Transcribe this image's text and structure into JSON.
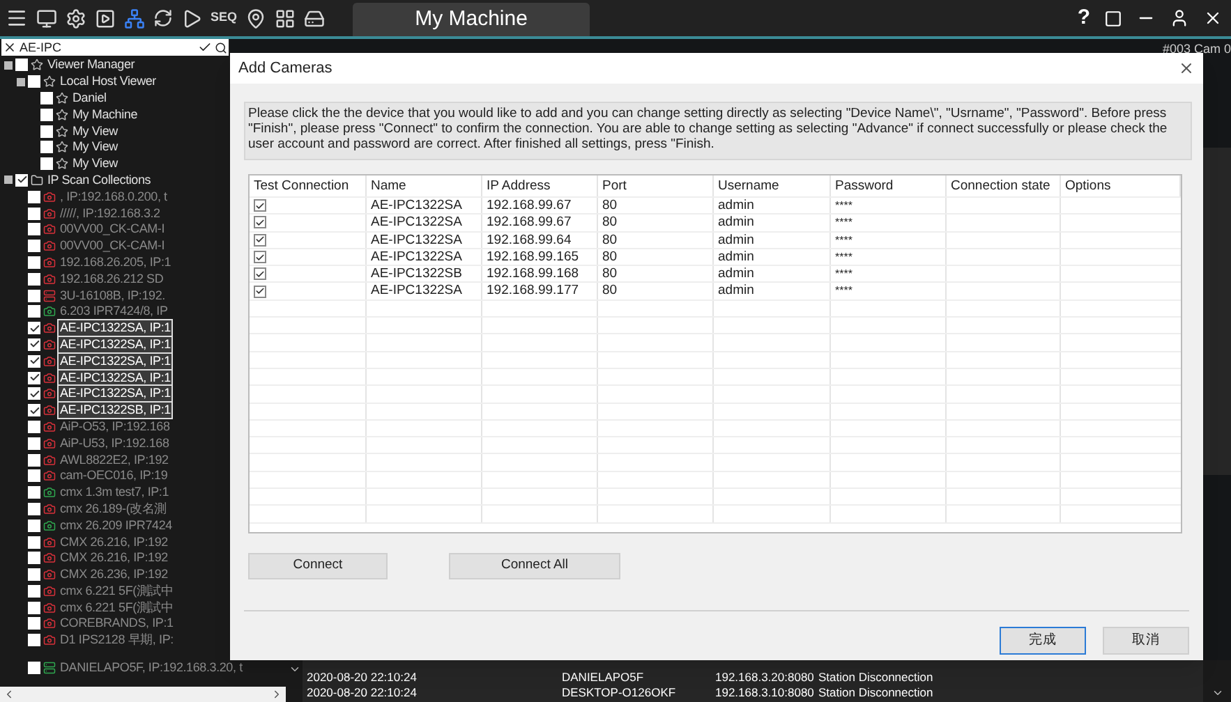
{
  "toolbar": {
    "seq_label": "SEQ",
    "tab_title": "My Machine",
    "help": "?"
  },
  "search": {
    "value": "AE-IPC"
  },
  "camera": {
    "label": "#003 Cam 0"
  },
  "tree": [
    {
      "label": "Viewer Manager",
      "kind": "folder",
      "checked": false,
      "expanded": true,
      "children": [
        {
          "label": "Local Host Viewer",
          "kind": "folder",
          "checked": false,
          "expanded": true,
          "children": [
            {
              "label": "Daniel",
              "kind": "view",
              "checked": false
            },
            {
              "label": "My Machine",
              "kind": "view",
              "checked": false
            },
            {
              "label": "My View",
              "kind": "view",
              "checked": false
            },
            {
              "label": "My View",
              "kind": "view",
              "checked": false
            },
            {
              "label": "My View",
              "kind": "view",
              "checked": false
            }
          ]
        }
      ]
    },
    {
      "label": "IP Scan Collections",
      "kind": "collection",
      "checked": true,
      "expanded": true,
      "children": [
        {
          "label": ", IP:192.168.0.200, t",
          "kind": "camera",
          "checked": false,
          "color": "#d9303a"
        },
        {
          "label": "/////, IP:192.168.3.2",
          "kind": "camera",
          "checked": false,
          "color": "#d9303a"
        },
        {
          "label": "00VV00_CK-CAM-I",
          "kind": "camera",
          "checked": false,
          "color": "#d9303a"
        },
        {
          "label": "00VV00_CK-CAM-I",
          "kind": "camera",
          "checked": false,
          "color": "#d9303a"
        },
        {
          "label": "192.168.26.205, IP:1",
          "kind": "camera",
          "checked": false,
          "color": "#d9303a"
        },
        {
          "label": "192.168.26.212 SD",
          "kind": "camera",
          "checked": false,
          "color": "#d9303a"
        },
        {
          "label": "3U-16108B, IP:192.",
          "kind": "recorder",
          "checked": false,
          "color": "#d9303a"
        },
        {
          "label": "6.203 IPR7424/8, IP",
          "kind": "camera",
          "checked": false,
          "color": "#2fa84f"
        },
        {
          "label": "AE-IPC1322SA, IP:1",
          "kind": "camera",
          "checked": true,
          "color": "#d9303a"
        },
        {
          "label": "AE-IPC1322SA, IP:1",
          "kind": "camera",
          "checked": true,
          "color": "#d9303a"
        },
        {
          "label": "AE-IPC1322SA, IP:1",
          "kind": "camera",
          "checked": true,
          "color": "#d9303a"
        },
        {
          "label": "AE-IPC1322SA, IP:1",
          "kind": "camera",
          "checked": true,
          "color": "#d9303a"
        },
        {
          "label": "AE-IPC1322SA, IP:1",
          "kind": "camera",
          "checked": true,
          "color": "#d9303a"
        },
        {
          "label": "AE-IPC1322SB, IP:1",
          "kind": "camera",
          "checked": true,
          "color": "#d9303a"
        },
        {
          "label": "AiP-O53, IP:192.168",
          "kind": "camera",
          "checked": false,
          "color": "#d9303a"
        },
        {
          "label": "AiP-U53, IP:192.168",
          "kind": "camera",
          "checked": false,
          "color": "#d9303a"
        },
        {
          "label": "AWL8822E2, IP:192",
          "kind": "camera",
          "checked": false,
          "color": "#d9303a"
        },
        {
          "label": "cam-OEC016, IP:19",
          "kind": "camera",
          "checked": false,
          "color": "#d9303a"
        },
        {
          "label": "cmx 1.3m test7, IP:1",
          "kind": "camera",
          "checked": false,
          "color": "#2fa84f"
        },
        {
          "label": "cmx 26.189-(改名測",
          "kind": "camera",
          "checked": false,
          "color": "#d9303a"
        },
        {
          "label": "cmx 26.209 IPR7424",
          "kind": "camera",
          "checked": false,
          "color": "#2fa84f"
        },
        {
          "label": "CMX 26.216, IP:192",
          "kind": "camera",
          "checked": false,
          "color": "#d9303a"
        },
        {
          "label": "CMX 26.216, IP:192",
          "kind": "camera",
          "checked": false,
          "color": "#d9303a"
        },
        {
          "label": "CMX 26.236, IP:192",
          "kind": "camera",
          "checked": false,
          "color": "#d9303a"
        },
        {
          "label": "cmx 6.221 5F(測試中",
          "kind": "camera",
          "checked": false,
          "color": "#d9303a"
        },
        {
          "label": "cmx 6.221 5F(測試中",
          "kind": "camera",
          "checked": false,
          "color": "#d9303a"
        },
        {
          "label": "COREBRANDS, IP:1",
          "kind": "camera",
          "checked": false,
          "color": "#d9303a"
        },
        {
          "label": "D1 IPS2128 早期, IP:",
          "kind": "camera",
          "checked": false,
          "color": "#d9303a"
        },
        {
          "label": "DANIELAPO5F, IP:192.168.3.20, t",
          "kind": "recorder",
          "checked": false,
          "color": "#2fa84f"
        }
      ]
    }
  ],
  "dialog": {
    "title": "Add Cameras",
    "instructions": "Please click the the device that you would like to add and you can change setting directly as selecting \"Device Name\\\", \"Usrname\", \"Password\". Before press \"Finish\", please press \"Connect\" to confirm the connection. You are able to change setting as selecting \"Advance\" if connect successfully or please check the user account and password are correct. After finished all settings, press \"Finish.",
    "columns": [
      "Test Connection",
      "Name",
      "IP Address",
      "Port",
      "Username",
      "Password",
      "Connection state",
      "Options"
    ],
    "rows": [
      {
        "test": true,
        "name": "AE-IPC1322SA",
        "ip": "192.168.99.67",
        "port": "80",
        "username": "admin",
        "password": "****"
      },
      {
        "test": true,
        "name": "AE-IPC1322SA",
        "ip": "192.168.99.67",
        "port": "80",
        "username": "admin",
        "password": "****"
      },
      {
        "test": true,
        "name": "AE-IPC1322SA",
        "ip": "192.168.99.64",
        "port": "80",
        "username": "admin",
        "password": "****"
      },
      {
        "test": true,
        "name": "AE-IPC1322SA",
        "ip": "192.168.99.165",
        "port": "80",
        "username": "admin",
        "password": "****"
      },
      {
        "test": true,
        "name": "AE-IPC1322SB",
        "ip": "192.168.99.168",
        "port": "80",
        "username": "admin",
        "password": "****"
      },
      {
        "test": true,
        "name": "AE-IPC1322SA",
        "ip": "192.168.99.177",
        "port": "80",
        "username": "admin",
        "password": "****"
      }
    ],
    "buttons": [
      "Connect",
      "Connect All"
    ],
    "footer_buttons": [
      {
        "label": "完成",
        "selected": true
      },
      {
        "label": "取消",
        "selected": false
      }
    ]
  },
  "log": [
    {
      "time": "2020-08-20 22:10:24",
      "host": "DANIELAPO5F",
      "ip": "192.168.3.20:8080",
      "event": "Station Disconnection"
    },
    {
      "time": "2020-08-20 22:10:24",
      "host": "DESKTOP-O126OKF",
      "ip": "192.168.3.10:8080",
      "event": "Station Disconnection"
    }
  ]
}
